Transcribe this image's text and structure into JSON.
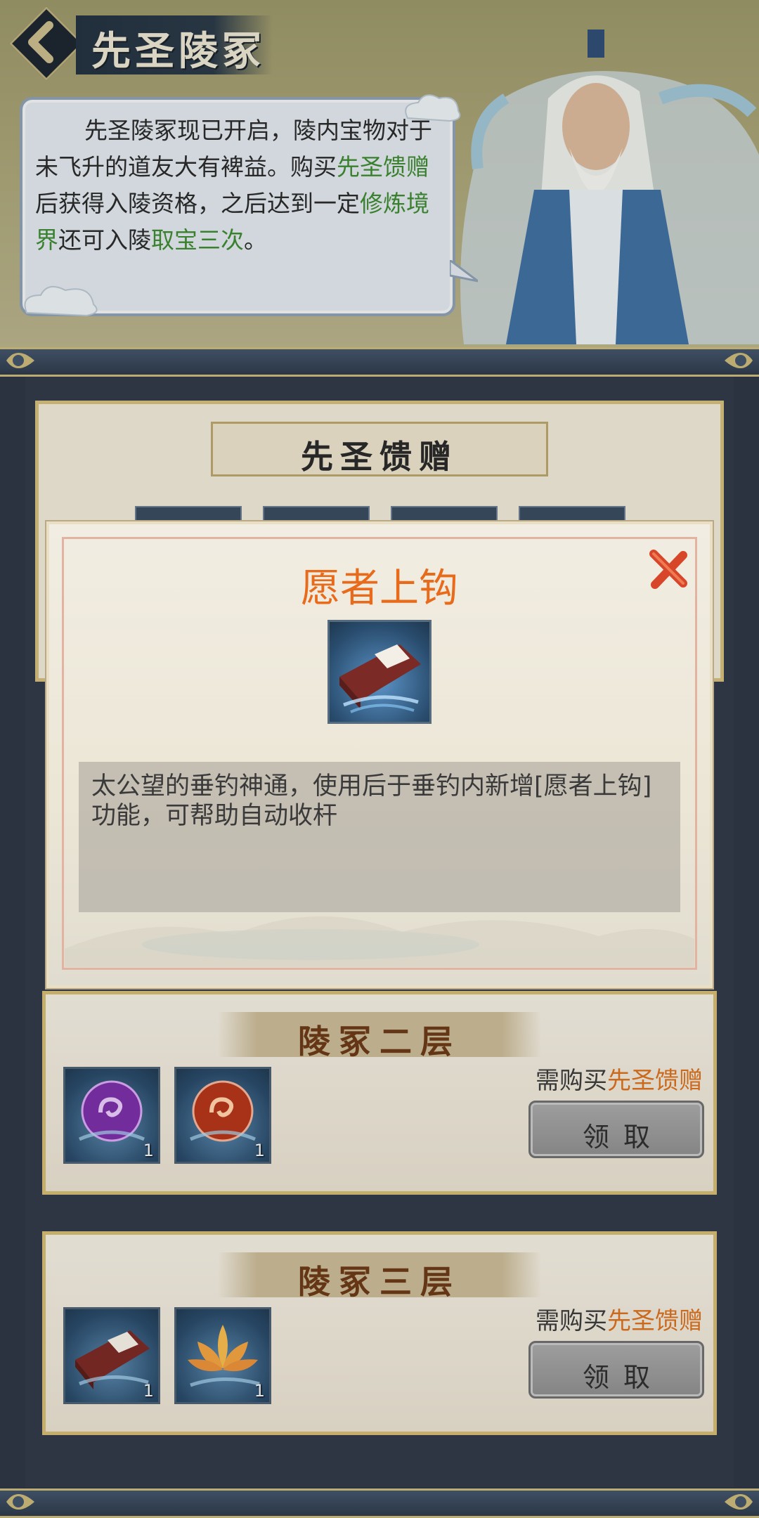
{
  "header": {
    "title": "先圣陵冢",
    "intro_parts": [
      {
        "text": "先圣陵冢现已开启，陵内宝物对于未飞升的道友大有裨益。购买",
        "highlight": false
      },
      {
        "text": "先圣馈赠",
        "highlight": true
      },
      {
        "text": "后获得入陵资格，之后达到一定",
        "highlight": false
      },
      {
        "text": "修炼境界",
        "highlight": true
      },
      {
        "text": "还可入陵",
        "highlight": false
      },
      {
        "text": "取宝三次",
        "highlight": true
      },
      {
        "text": "。",
        "highlight": false
      }
    ]
  },
  "gift_section": {
    "title": "先圣馈赠"
  },
  "floors": [
    {
      "title": "陵冢二层",
      "requirement_prefix": "需购买",
      "requirement_item": "先圣馈赠",
      "claim_label": "领取",
      "items": [
        {
          "icon": "purple-orb-icon",
          "count": "1"
        },
        {
          "icon": "red-orb-icon",
          "count": "1"
        }
      ]
    },
    {
      "title": "陵冢三层",
      "requirement_prefix": "需购买",
      "requirement_item": "先圣馈赠",
      "claim_label": "领取",
      "items": [
        {
          "icon": "book-icon",
          "count": "1"
        },
        {
          "icon": "lotus-icon",
          "count": "1"
        }
      ]
    }
  ],
  "popup": {
    "title": "愿者上钩",
    "item_icon": "book-icon",
    "description": "太公望的垂钓神通，使用后于垂钓内新增[愿者上钩]功能，可帮助自动收杆"
  },
  "colors": {
    "highlight_green": "#3e8a32",
    "popup_title_orange": "#e86b1c",
    "requirement_orange": "#d8701f",
    "floor_title_brown": "#6b3a17"
  }
}
